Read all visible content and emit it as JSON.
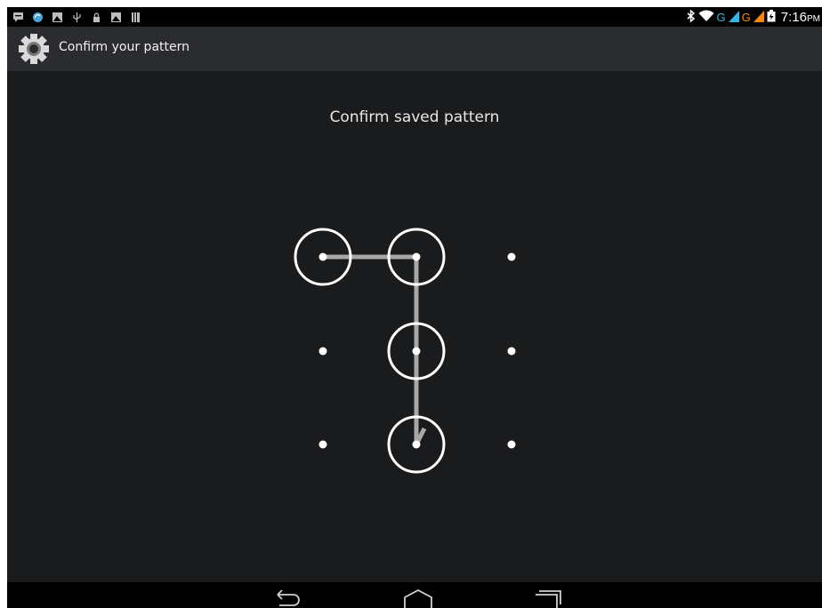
{
  "status_bar": {
    "left_icons": [
      "chat-notification-icon",
      "sync-icon",
      "image-notification-icon",
      "usb-icon",
      "lock-icon",
      "image-notification-icon",
      "storage-icon"
    ],
    "right_icons": [
      "bluetooth-icon",
      "wifi-icon",
      "signal-sim1-icon",
      "signal-sim2-icon",
      "battery-charging-icon"
    ],
    "network_1": "G",
    "network_2": "G",
    "time": "7:16",
    "ampm": "PM",
    "colors": {
      "sim1": "#33b5e5",
      "sim2": "#ff8800"
    }
  },
  "action_bar": {
    "title": "Confirm your pattern",
    "icon": "settings-gear-icon"
  },
  "main": {
    "prompt": "Confirm saved pattern",
    "pattern_grid": {
      "rows": 3,
      "cols": 3,
      "selected_sequence": [
        1,
        2,
        5,
        8
      ],
      "trail_color": "#a8a8a8",
      "ring_color": "#ffffff"
    }
  },
  "nav_bar": {
    "buttons": [
      "back-icon",
      "home-icon",
      "recents-icon"
    ]
  }
}
